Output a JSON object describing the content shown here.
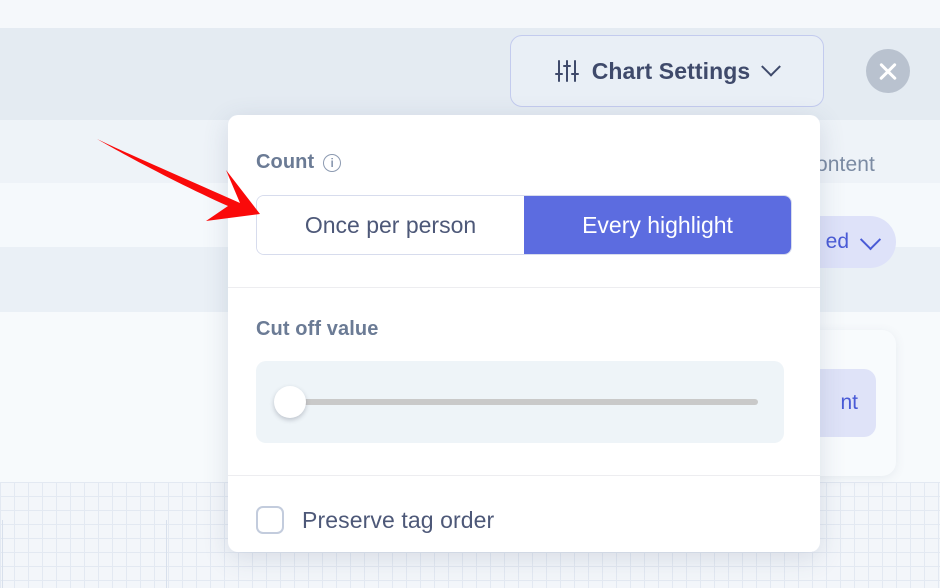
{
  "toolbar": {
    "chart_settings_label": "Chart Settings",
    "chart_settings_icon": "sliders-icon",
    "chart_settings_chevron_icon": "chevron-down-icon",
    "close_icon": "close-icon"
  },
  "background": {
    "right_label": "ontent",
    "right_pill_text": "ed",
    "right_pill_chevron_icon": "chevron-down-icon",
    "right_tag_text": "nt"
  },
  "popover": {
    "count": {
      "label": "Count",
      "info_icon": "info-icon",
      "options": [
        {
          "label": "Once per person",
          "selected": false
        },
        {
          "label": "Every highlight",
          "selected": true
        }
      ]
    },
    "cutoff": {
      "label": "Cut off value",
      "slider_value_percent": 0,
      "slider_min": 0,
      "slider_max": 100
    },
    "preserve": {
      "label": "Preserve tag order",
      "checked": false
    }
  },
  "annotation": {
    "arrow_color": "#fa0a0a",
    "arrow_target": "once-per-person-option"
  },
  "colors": {
    "accent_purple": "#5c6ce0",
    "accent_purple_soft": "#dee2f9",
    "text_primary": "#4d5878",
    "text_muted": "#6b7b95",
    "panel_bg": "#ffffff",
    "page_bg": "#f5f8fb",
    "toolbar_bg": "#e4ebf2",
    "close_btn_bg": "#b9c2cf"
  }
}
